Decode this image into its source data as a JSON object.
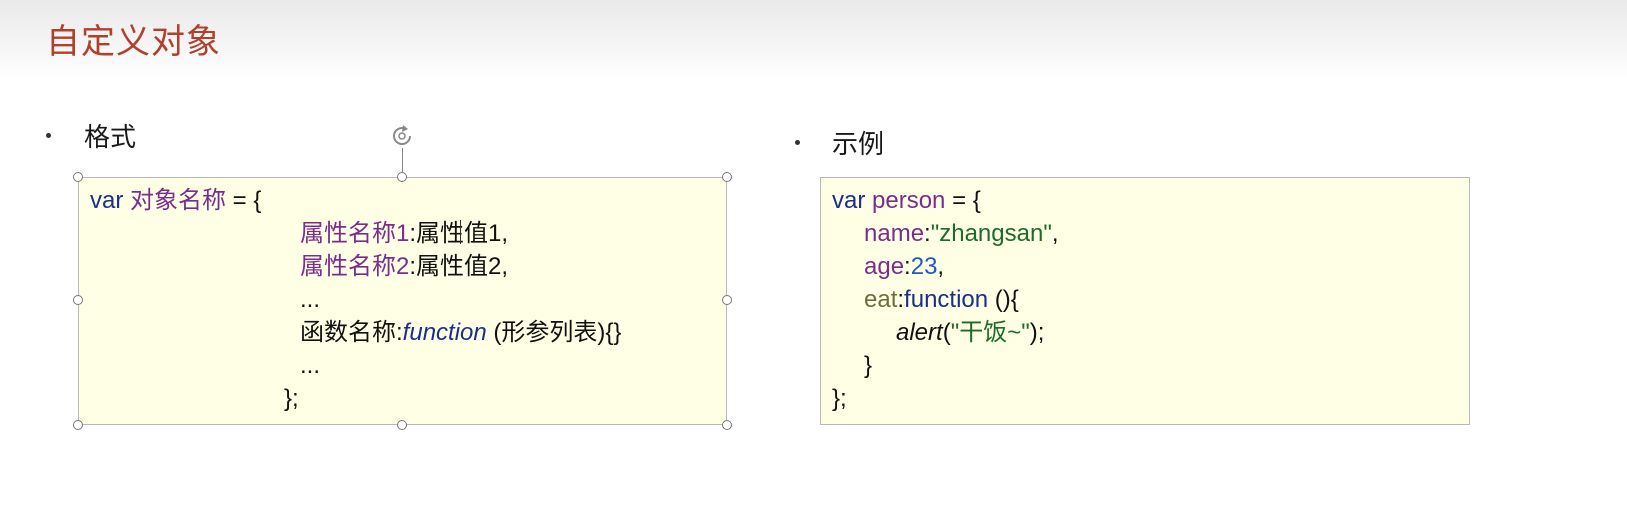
{
  "slide": {
    "title": "自定义对象"
  },
  "format": {
    "heading": "格式",
    "code": {
      "l1_kw": "var",
      "l1_name": "对象名称",
      "l1_rest": " = {",
      "l2_prop": "属性名称1",
      "l2_rest": ":属性值1,",
      "l3_prop": "属性名称2",
      "l3_rest": ":属性值2,",
      "l4": "...",
      "l5_name": "函数名称:",
      "l5_fn": "function",
      "l5_rest": " (形参列表){}",
      "l6": "...",
      "l7": "};"
    }
  },
  "example": {
    "heading": "示例",
    "code": {
      "l1_kw": "var",
      "l1_name": "person",
      "l1_rest": " = {",
      "l2_prop": "name",
      "l2_colon": ":",
      "l2_val": "\"zhangsan\"",
      "l2_comma": ",",
      "l3_prop": "age",
      "l3_colon": ":",
      "l3_val": "23",
      "l3_comma": ",",
      "l4_prop": "eat",
      "l4_colon": ":",
      "l4_fn": "function",
      "l4_rest": " (){",
      "l5_call": "alert",
      "l5_open": "(",
      "l5_str": "\"干饭~\"",
      "l5_close": ");",
      "l6": "}",
      "l7": "};"
    }
  },
  "colors": {
    "title": "#b0402c",
    "keyword": "#1a2f8c",
    "identifier": "#7b2d8e",
    "string": "#1d6b2a",
    "number": "#2255cc",
    "box_fill": "#ffffe6"
  }
}
